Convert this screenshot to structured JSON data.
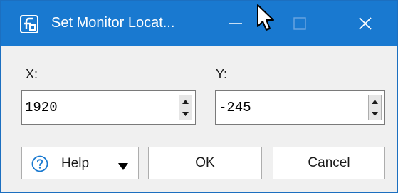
{
  "window": {
    "title": "Set Monitor Locat...",
    "app_icon": "stylized-f-app-icon",
    "controls": [
      "minimize-icon",
      "maximize-icon",
      "close-icon"
    ]
  },
  "fields": {
    "x": {
      "label": "X:",
      "value": "1920"
    },
    "y": {
      "label": "Y:",
      "value": "-245"
    }
  },
  "buttons": {
    "help": "Help",
    "ok": "OK",
    "cancel": "Cancel"
  },
  "colors": {
    "titlebar": "#1979d0",
    "background": "#f0f0f0",
    "help_icon": "#1979d0"
  }
}
